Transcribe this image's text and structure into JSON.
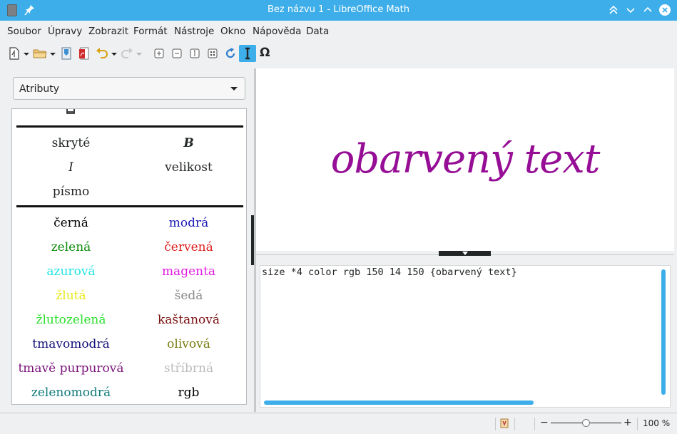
{
  "window": {
    "title": "Bez názvu 1 - LibreOffice Math"
  },
  "menu": [
    {
      "id": "soubor",
      "label": "Soubor"
    },
    {
      "id": "upravy",
      "label": "Úpravy"
    },
    {
      "id": "zobrazit",
      "label": "Zobrazit"
    },
    {
      "id": "format",
      "label": "Formát"
    },
    {
      "id": "nastroje",
      "label": "Nástroje"
    },
    {
      "id": "okno",
      "label": "Okno"
    },
    {
      "id": "napoveda",
      "label": "Nápověda"
    },
    {
      "id": "data",
      "label": "Data"
    }
  ],
  "toolbar": {
    "icons": [
      "new-document-icon",
      "open-folder-icon",
      "save-icon",
      "export-pdf-icon",
      "undo-icon",
      "redo-icon",
      "zoom-in-icon",
      "zoom-out-icon",
      "zoom-100-icon",
      "show-all-icon",
      "update-icon",
      "formula-cursor-icon",
      "symbols-omega-icon"
    ],
    "omega_label": "Ω"
  },
  "elements_panel": {
    "category_selected": "Atributy",
    "group_attributes": [
      "skryté",
      "B",
      "I",
      "velikost",
      "písmo"
    ],
    "colors": [
      {
        "label": "černá",
        "color": "#000000"
      },
      {
        "label": "modrá",
        "color": "#1a1ab5"
      },
      {
        "label": "zelená",
        "color": "#0c8a0c"
      },
      {
        "label": "červená",
        "color": "#e01b1b"
      },
      {
        "label": "azurová",
        "color": "#22e4e4"
      },
      {
        "label": "magenta",
        "color": "#e01be0"
      },
      {
        "label": "žlutá",
        "color": "#e8e81a"
      },
      {
        "label": "šedá",
        "color": "#8a8a8a"
      },
      {
        "label": "žlutozelená",
        "color": "#2ce02c"
      },
      {
        "label": "kaštanová",
        "color": "#7a1010"
      },
      {
        "label": "tmavomodrá",
        "color": "#11117a"
      },
      {
        "label": "olivová",
        "color": "#7a7a10"
      },
      {
        "label": "tmavě purpurová",
        "color": "#7a117a"
      },
      {
        "label": "stříbrná",
        "color": "#bcbcbc"
      },
      {
        "label": "zelenomodrá",
        "color": "#117a7a"
      },
      {
        "label": "rgb",
        "color": "#000000"
      }
    ]
  },
  "preview": {
    "formula_text": "obarvený text",
    "formula_color": "#960e96"
  },
  "editor": {
    "content": "size *4 color rgb 150 14 150 {obarvený text}"
  },
  "statusbar": {
    "zoom_minus": "−",
    "zoom_plus": "+",
    "zoom_level": 0.5,
    "zoom_value": "100 %"
  },
  "colors": {
    "accent": "#3daee9",
    "window_bg": "#eff0f1"
  }
}
